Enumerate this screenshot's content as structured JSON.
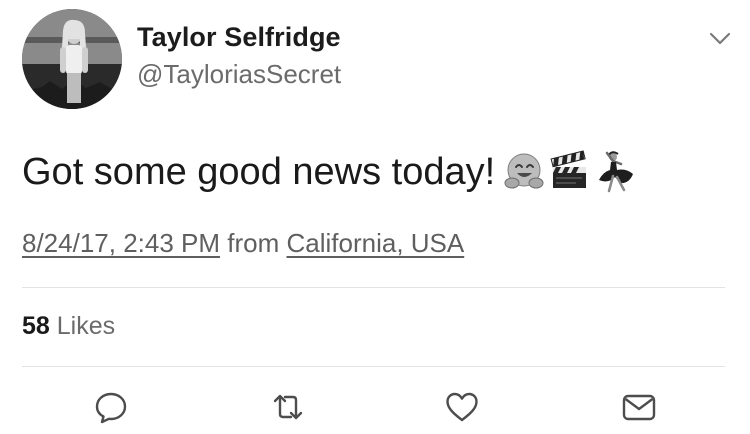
{
  "user": {
    "display_name": "Taylor Selfridge",
    "handle": "@TayloriasSecret"
  },
  "tweet": {
    "text": "Got some good news today!",
    "emojis": [
      "hugging-face-emoji",
      "clapper-board-emoji",
      "dancer-emoji"
    ],
    "date": "8/24/17, 2:43 PM",
    "from_label": "from",
    "location": "California, USA"
  },
  "stats": {
    "likes_count": "58",
    "likes_label": "Likes"
  },
  "actions": {
    "icons": [
      "reply-icon",
      "retweet-icon",
      "like-icon",
      "direct-message-icon"
    ]
  },
  "menu": {
    "icon": "chevron-down-icon"
  }
}
